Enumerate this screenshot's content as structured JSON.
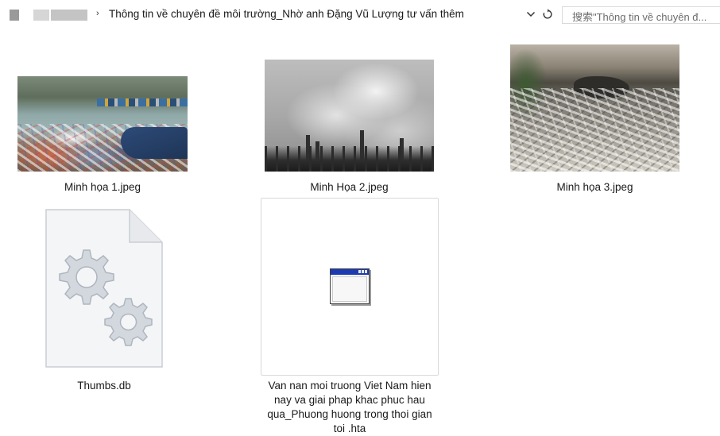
{
  "address_bar": {
    "separator": "›",
    "current_folder": "Thông tin về chuyên đề môi trường_Nhờ anh Đặng Vũ Lượng tư vấn thêm",
    "search_placeholder": "搜索\"Thông tin về chuyên đ..."
  },
  "icons": {
    "dropdown": "chevron-down-icon",
    "refresh": "refresh-icon",
    "settings_file": "gear-file-icon",
    "hta_app": "application-window-icon"
  },
  "files": [
    {
      "name": "Minh họa 1.jpeg",
      "kind": "image"
    },
    {
      "name": "Minh Họa 2.jpeg",
      "kind": "image"
    },
    {
      "name": "Minh họa 3.jpeg",
      "kind": "image"
    },
    {
      "name": "Thumbs.db",
      "kind": "system"
    },
    {
      "name": "Van nan moi truong Viet Nam hien nay va giai phap khac phuc hau qua_Phuong huong trong thoi gian toi .hta",
      "kind": "hta"
    }
  ],
  "colors": {
    "hta_titlebar": "#1c3bb0",
    "gear_fill": "#cfd4dc",
    "text": "#1a1a1a"
  }
}
